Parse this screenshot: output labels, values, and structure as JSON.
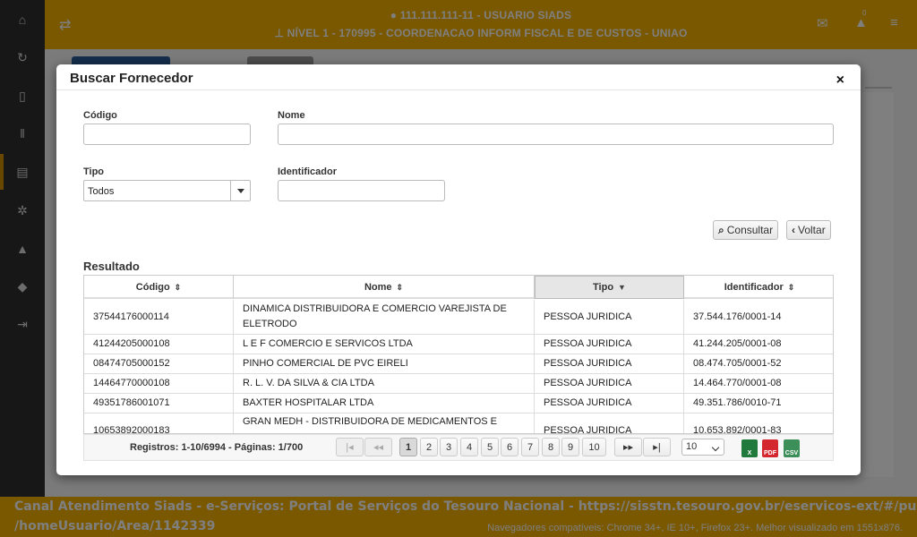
{
  "background": {
    "sidebar_icons": [
      "home-icon",
      "refresh-icon",
      "document-icon",
      "barcode-icon",
      "archive-icon",
      "cogs-icon",
      "warning-icon",
      "graduation-cap-icon",
      "sign-out-icon"
    ],
    "header": {
      "user_line": "111.111.111-11 - USUARIO SIADS",
      "level_line": "NÍVEL 1 - 170995 - COORDENACAO INFORM FISCAL E DE CUSTOS - UNIAO",
      "notification_count": "0"
    },
    "footer": {
      "line1": "Canal Atendimento Siads - e-Serviços: Portal de Serviços do Tesouro Nacional - https://sisstn.tesouro.gov.br/eservicos-ext/#/public",
      "line2": "/homeUsuario/Area/1142339",
      "compat": "Navegadores compatíveis: Chrome 34+, IE 10+, Firefox 23+. Melhor visualizado em 1551x876."
    }
  },
  "modal": {
    "title": "Buscar Fornecedor",
    "close_glyph": "×",
    "form": {
      "codigo_label": "Código",
      "codigo_value": "",
      "nome_label": "Nome",
      "nome_value": "",
      "tipo_label": "Tipo",
      "tipo_value": "Todos",
      "identificador_label": "Identificador",
      "identificador_value": ""
    },
    "buttons": {
      "consultar": "Consultar",
      "voltar": "Voltar"
    },
    "result_title": "Resultado",
    "columns": [
      "Código",
      "Nome",
      "Tipo",
      "Identificador"
    ],
    "sorted_column": "Tipo",
    "rows": [
      {
        "codigo": "37544176000114",
        "nome": "DINAMICA DISTRIBUIDORA E COMERCIO VAREJISTA DE ELETRODO",
        "tipo": "PESSOA JURIDICA",
        "identificador": "37.544.176/0001-14"
      },
      {
        "codigo": "41244205000108",
        "nome": "L E F COMERCIO E SERVICOS LTDA",
        "tipo": "PESSOA JURIDICA",
        "identificador": "41.244.205/0001-08"
      },
      {
        "codigo": "08474705000152",
        "nome": "PINHO COMERCIAL DE PVC EIRELI",
        "tipo": "PESSOA JURIDICA",
        "identificador": "08.474.705/0001-52"
      },
      {
        "codigo": "14464770000108",
        "nome": "R. L. V. DA SILVA & CIA LTDA",
        "tipo": "PESSOA JURIDICA",
        "identificador": "14.464.770/0001-08"
      },
      {
        "codigo": "49351786001071",
        "nome": "BAXTER HOSPITALAR LTDA",
        "tipo": "PESSOA JURIDICA",
        "identificador": "49.351.786/0010-71"
      },
      {
        "codigo": "10653892000183",
        "nome": "GRAN MEDH - DISTRIBUIDORA DE MEDICAMENTOS E",
        "tipo": "PESSOA JURIDICA",
        "identificador": "10.653.892/0001-83"
      }
    ],
    "pager": {
      "info": "Registros: 1-10/6994 - Páginas: 1/700",
      "first": "|◂",
      "prev": "◂◂",
      "pages": [
        "1",
        "2",
        "3",
        "4",
        "5",
        "6",
        "7",
        "8",
        "9",
        "10"
      ],
      "current_page": "1",
      "next": "▸▸",
      "last": "▸|",
      "page_size": "10",
      "exports": [
        "excel-export-icon",
        "pdf-export-icon",
        "csv-export-icon"
      ]
    }
  }
}
